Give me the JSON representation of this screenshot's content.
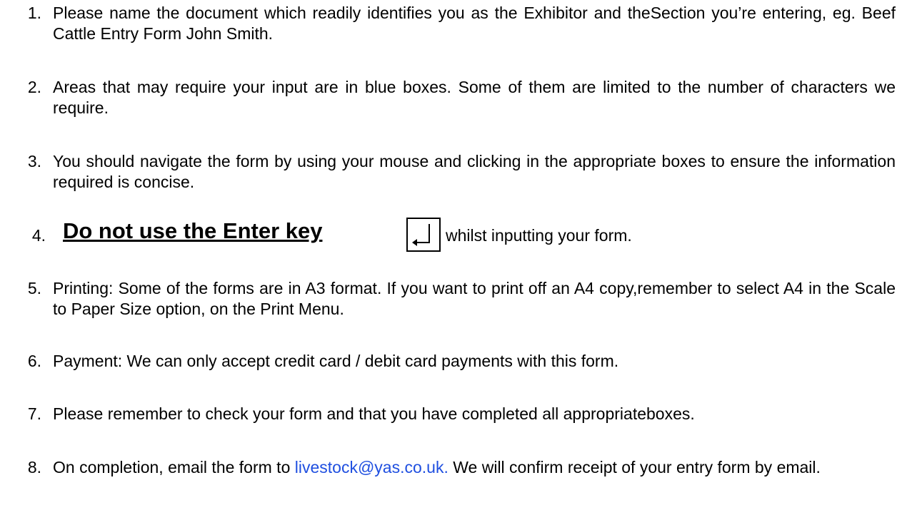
{
  "items": [
    {
      "number": "1.",
      "text": "Please name the document which readily identifies you as the Exhibitor and theSection you’re entering, eg. Beef Cattle Entry Form John Smith."
    },
    {
      "number": "2.",
      "text": "Areas that may require your input are in blue boxes. Some of them are limited to the number of characters we require."
    },
    {
      "number": "3.",
      "text": "You should navigate the form by using your mouse and clicking in the appropriate boxes to ensure the information required is concise."
    },
    {
      "number": "4.",
      "emphasis": "Do not use the Enter key",
      "icon": "enter-key-icon",
      "text_after": "whilst inputting your form."
    },
    {
      "number": "5.",
      "text": "Printing: Some of the forms are in A3 format. If you want to print off an A4 copy,remember to select A4 in the Scale to Paper Size option, on the Print  Menu."
    },
    {
      "number": "6.",
      "text": "Payment: We can only accept credit card / debit card payments with this  form."
    },
    {
      "number": "7.",
      "text": "Please remember to check your form and that you have completed all appropriateboxes."
    },
    {
      "number": "8.",
      "text_before": "On completion, email the form to ",
      "email": "livestock@yas.co.uk.",
      "text_after": " We will confirm receipt of your entry form by  email."
    }
  ],
  "colors": {
    "text": "#000000",
    "link": "#1f4fe0",
    "background": "#ffffff"
  }
}
